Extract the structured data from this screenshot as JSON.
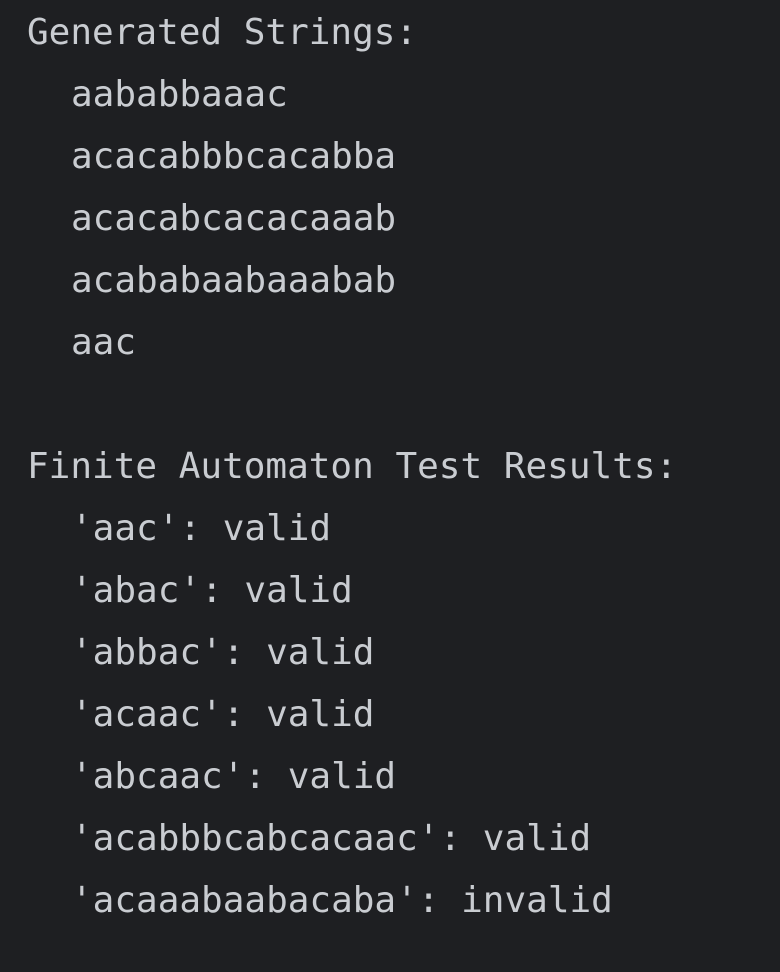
{
  "output": {
    "generated_header": "Generated Strings:",
    "generated": [
      "aababbaaac",
      "acacabbbcacabba",
      "acacabcacacaaab",
      "acababaabaaabab",
      "aac"
    ],
    "results_header": "Finite Automaton Test Results:",
    "results": [
      "'aac': valid",
      "'abac': valid",
      "'abbac': valid",
      "'acaac': valid",
      "'abcaac': valid",
      "'acabbbcabcacaac': valid",
      "'acaaabaabacaba': invalid"
    ]
  },
  "colors": {
    "background": "#1e1f22",
    "text": "#c9ccd1"
  }
}
